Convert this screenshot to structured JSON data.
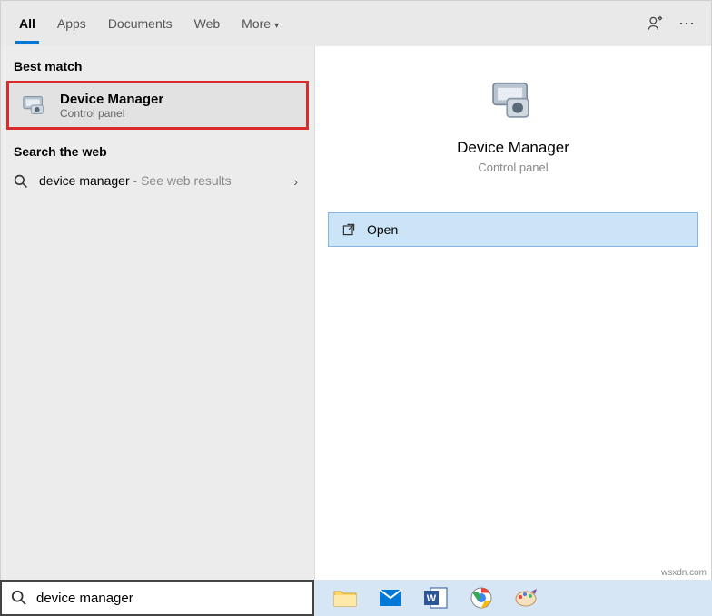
{
  "tabs": {
    "all": "All",
    "apps": "Apps",
    "documents": "Documents",
    "web": "Web",
    "more": "More"
  },
  "sections": {
    "best_match": "Best match",
    "search_web": "Search the web"
  },
  "result": {
    "title": "Device Manager",
    "sub": "Control panel"
  },
  "web_result": {
    "query": "device manager",
    "hint": " - See web results"
  },
  "preview": {
    "title": "Device Manager",
    "sub": "Control panel"
  },
  "action": {
    "open": "Open"
  },
  "search": {
    "value": "device manager"
  },
  "watermark": "wsxdn.com"
}
